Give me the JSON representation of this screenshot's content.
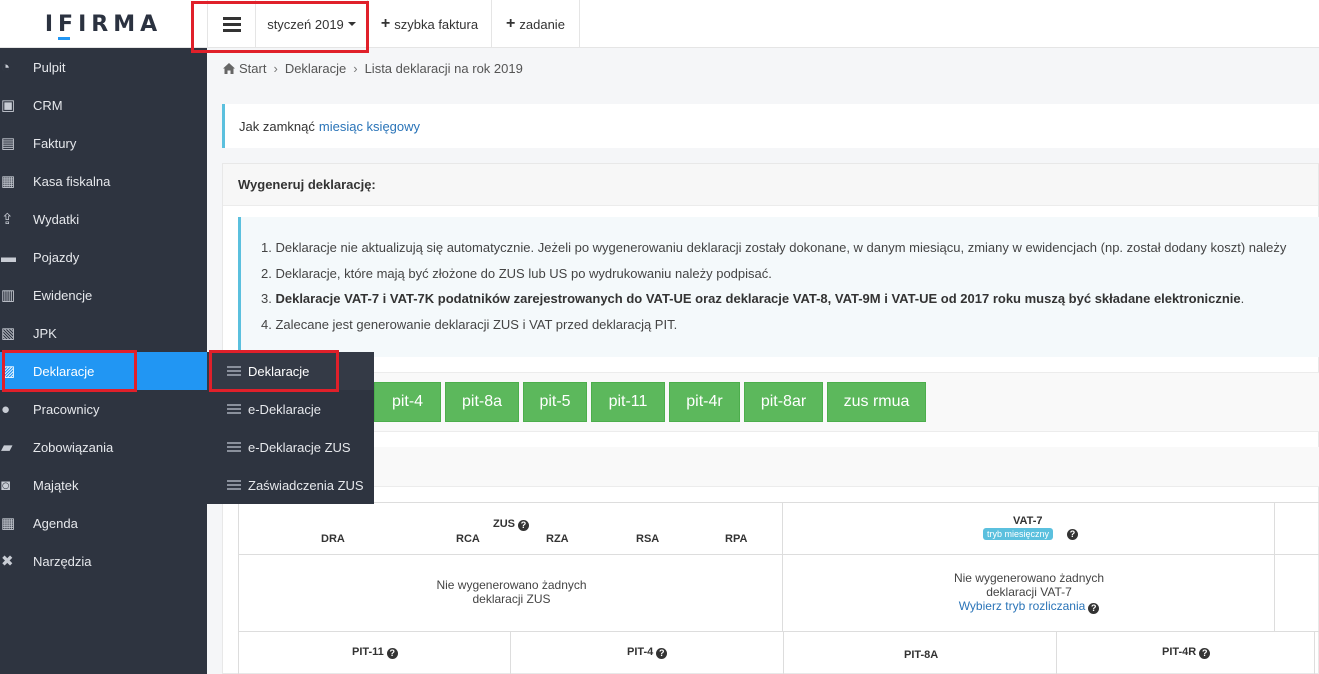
{
  "app": {
    "logo": "IFIRMA"
  },
  "topbar": {
    "month": "styczeń 2019",
    "quick_invoice": "szybka faktura",
    "task": "zadanie"
  },
  "sidebar": {
    "items": [
      {
        "label": "Pulpit",
        "icon": "dashboard-icon"
      },
      {
        "label": "CRM",
        "icon": "contacts-icon"
      },
      {
        "label": "Faktury",
        "icon": "invoice-icon"
      },
      {
        "label": "Kasa fiskalna",
        "icon": "cash-register-icon"
      },
      {
        "label": "Wydatki",
        "icon": "upload-icon"
      },
      {
        "label": "Pojazdy",
        "icon": "truck-icon"
      },
      {
        "label": "Ewidencje",
        "icon": "ledger-icon"
      },
      {
        "label": "JPK",
        "icon": "jpk-icon"
      },
      {
        "label": "Deklaracje",
        "icon": "declaration-icon"
      },
      {
        "label": "Pracownicy",
        "icon": "employee-icon"
      },
      {
        "label": "Zobowiązania",
        "icon": "wallet-icon"
      },
      {
        "label": "Majątek",
        "icon": "camera-icon"
      },
      {
        "label": "Agenda",
        "icon": "calendar-icon"
      },
      {
        "label": "Narzędzia",
        "icon": "tools-icon"
      }
    ]
  },
  "submenu": {
    "items": [
      "Deklaracje",
      "e-Deklaracje",
      "e-Deklaracje ZUS",
      "Zaświadczenia ZUS"
    ]
  },
  "breadcrumb": {
    "home": "Start",
    "level1": "Deklaracje",
    "current": "Lista deklaracji na rok 2019"
  },
  "info": {
    "text": "Jak zamknąć",
    "link": "miesiąc księgowy"
  },
  "panel": {
    "title": "Wygeneruj deklarację:",
    "notes": [
      "1. Deklaracje nie aktualizują się automatycznie. Jeżeli po wygenerowaniu deklaracji zostały dokonane, w danym miesiącu, zmiany w ewidencjach (np. został dodany koszt) należy",
      "2. Deklaracje, które mają być złożone do ZUS lub US po wydrukowaniu należy podpisać.",
      "Deklaracje VAT-7 i VAT-7K podatników zarejestrowanych do VAT-UE oraz deklaracje VAT-8, VAT-9M i VAT-UE od 2017 roku muszą być składane elektronicznie",
      "4. Zalecane jest generowanie deklaracji ZUS i VAT przed deklaracją PIT."
    ],
    "note3_prefix": "3. ",
    "note3_suffix": "."
  },
  "buttons": [
    "pit-4",
    "pit-8a",
    "pit-5",
    "pit-11",
    "pit-4r",
    "pit-8ar",
    "zus rmua"
  ],
  "table": {
    "zus_header": "ZUS",
    "zus_cols": [
      "DRA",
      "RCA",
      "RZA",
      "RSA",
      "RPA"
    ],
    "vat_header": "VAT-7",
    "vat_badge": "tryb miesięczny",
    "zus_empty_1": "Nie wygenerowano żadnych",
    "zus_empty_2": "deklaracji ZUS",
    "vat_empty_1": "Nie wygenerowano żadnych",
    "vat_empty_2": "deklaracji VAT-7",
    "vat_link": "Wybierz tryb rozliczania",
    "pit_cols": [
      "PIT-11",
      "PIT-4",
      "PIT-8A",
      "PIT-4R"
    ]
  },
  "colors": {
    "accent": "#2196f3",
    "sidebar": "#2e3440",
    "green": "#5cb85c",
    "info": "#5bc0de",
    "highlight": "#e0202a"
  }
}
